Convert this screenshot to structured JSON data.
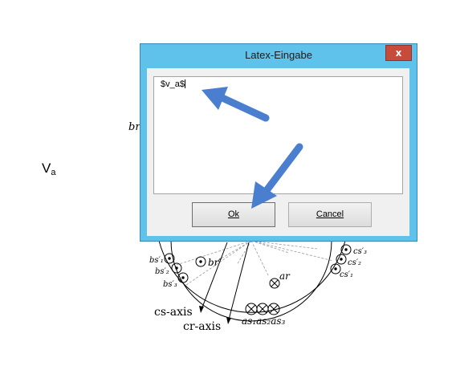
{
  "background_text": {
    "va_main": "V",
    "va_sub": "a",
    "br": "br"
  },
  "diagram": {
    "labels": {
      "bs1": "bs′₁",
      "bs2": "bs′₂",
      "bs3": "bs′₃",
      "brp": "br′",
      "ar": "ar",
      "cs3": "cs′₃",
      "cs2": "cs′₂",
      "cs1": "cs′₁",
      "as_labels": "as₁as₂as₃",
      "cs_axis": "cs-axis",
      "cr_axis": "cr-axis"
    }
  },
  "dialog": {
    "title": "Latex-Eingabe",
    "close_glyph": "x",
    "input_value": "$v_a$",
    "ok_label": "Ok",
    "cancel_label": "Cancel"
  },
  "colors": {
    "titlebar": "#5fc2ea",
    "close": "#c74b3b",
    "arrow": "#4a7fd0"
  }
}
